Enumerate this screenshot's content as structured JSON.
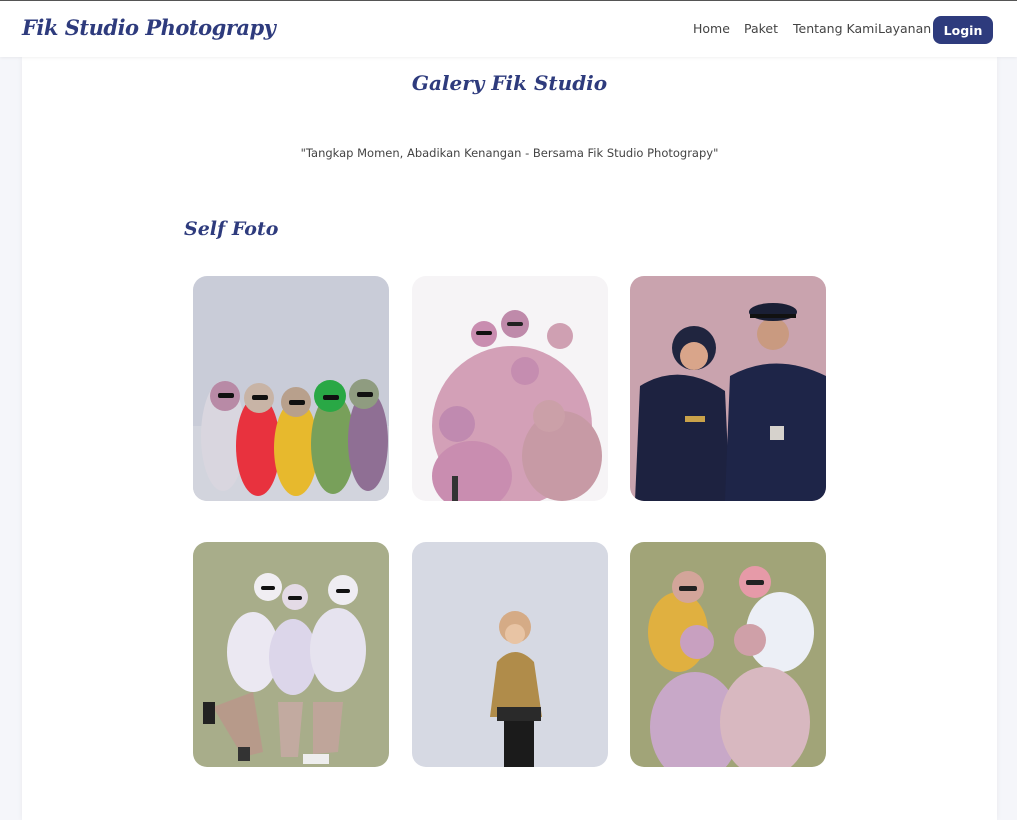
{
  "navbar": {
    "brand": "Fik Studio Photograpy",
    "links": [
      "Home",
      "Paket",
      "Tentang Kami",
      "Layanan"
    ],
    "login_label": "Login"
  },
  "gallery": {
    "title": "Galery Fik Studio",
    "tagline": "\"Tangkap Momen, Abadikan Kenangan - Bersama Fik Studio Photograpy\"",
    "section_title": "Self Foto"
  },
  "colors": {
    "brand": "#2e3b7d",
    "button": "#2e3b7d"
  }
}
